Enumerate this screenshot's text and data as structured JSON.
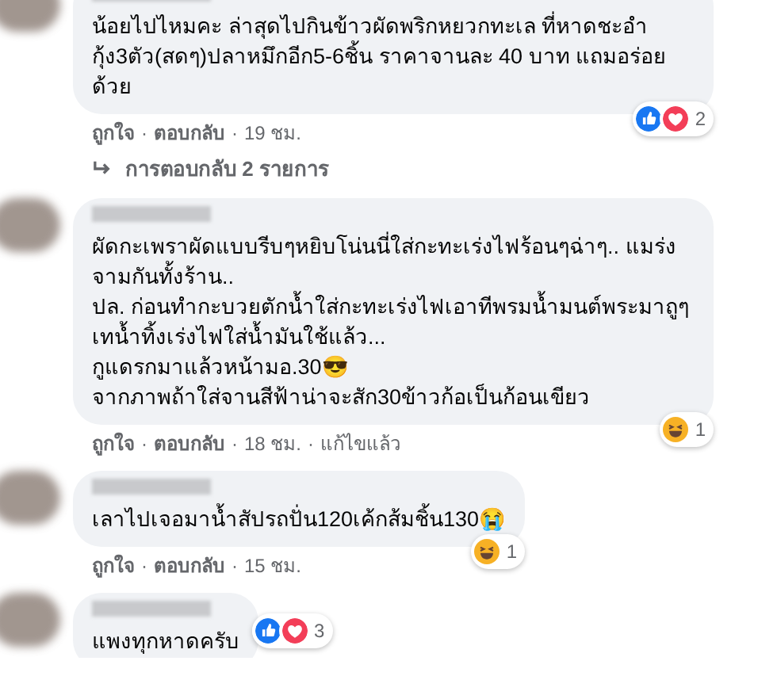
{
  "comments": [
    {
      "paragraphs": [
        "น้อยไปไหมคะ ล่าสุดไปกินข้าวผัดพริกหยวกทะเล ที่หาดชะอำ กุ้ง3ตัว(สดๆ)ปลาหมึกอีก5-6ชิ้น ราคาจานละ 40 บาท แถมอร่อยด้วย"
      ],
      "reactions": {
        "kind": "corner",
        "icons": [
          {
            "kind": "like"
          },
          {
            "kind": "love"
          }
        ],
        "count": "2"
      },
      "actions": [
        "ถูกใจ",
        "·",
        "ตอบกลับ",
        "·",
        "19 ชม."
      ],
      "replies": "การตอบกลับ 2 รายการ"
    },
    {
      "paragraphs": [
        "ผัดกะเพราผัดแบบรีบๆหยิบโน่นนี่ใส่กะทะเร่งไฟร้อนๆฉ่าๆ.. แมร่งจามกันทั้งร้าน..",
        "ปล. ก่อนทำกะบวยตักน้ำใส่กะทะเร่งไฟเอาทีพรมน้ำมนต์พระมาถูๆเทน้ำทิ้งเร่งไฟใส่น้ำมันใช้แล้ว...",
        "กูแดรกมาแล้วหน้ามอ.30😎",
        "จากภาพถ้าใส่จานสีฟ้าน่าจะสัก30ข้าวก้อเป็นก้อนเขียว"
      ],
      "reactions": {
        "kind": "corner",
        "icons": [
          {
            "kind": "haha"
          }
        ],
        "count": "1"
      },
      "actions": [
        "ถูกใจ",
        "·",
        "ตอบกลับ",
        "·",
        "18 ชม.",
        "·",
        "แก้ไขแล้ว"
      ]
    },
    {
      "paragraphs": [
        "เลาไปเจอมาน้ำสัปรถปั่น120เค้กส้มชิ้น130😭"
      ],
      "reactions": {
        "kind": "corner",
        "icons": [
          {
            "kind": "haha"
          }
        ],
        "count": "1"
      },
      "actions": [
        "ถูกใจ",
        "·",
        "ตอบกลับ",
        "·",
        "15 ชม."
      ]
    },
    {
      "paragraphs": [
        "แพงทุกหาดครับ"
      ],
      "reactions": {
        "kind": "side",
        "icons": [
          {
            "kind": "like"
          },
          {
            "kind": "love"
          }
        ],
        "count": "3"
      }
    }
  ]
}
